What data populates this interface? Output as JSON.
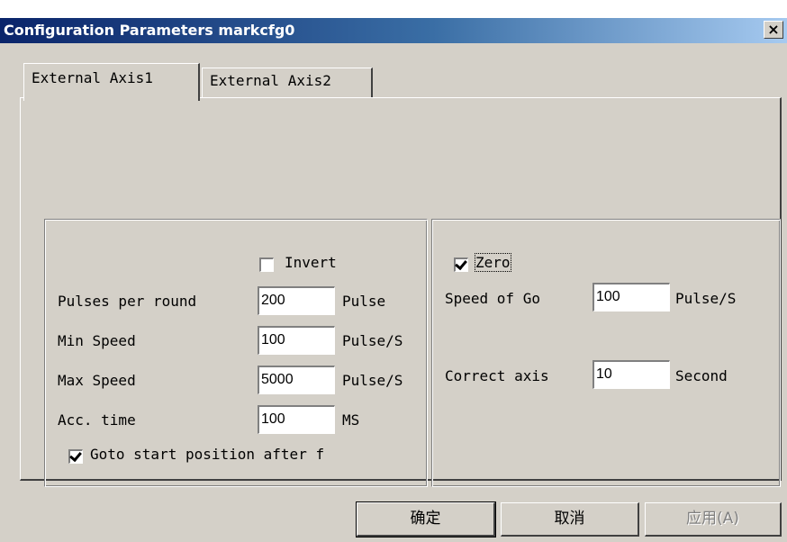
{
  "window": {
    "title": "Configuration Parameters markcfg0",
    "close_label": "×"
  },
  "tabs": [
    {
      "label": "External Axis1",
      "active": true
    },
    {
      "label": "External Axis2",
      "active": false
    }
  ],
  "left_group": {
    "invert": {
      "label": "Invert",
      "checked": false
    },
    "pulses_per_round": {
      "label": "Pulses per round",
      "value": "200",
      "unit": "Pulse"
    },
    "min_speed": {
      "label": "Min Speed",
      "value": "100",
      "unit": "Pulse/S"
    },
    "max_speed": {
      "label": "Max Speed",
      "value": "5000",
      "unit": "Pulse/S"
    },
    "acc_time": {
      "label": "Acc. time",
      "value": "100",
      "unit": "MS"
    },
    "goto_start": {
      "label": "Goto start position after f",
      "checked": true
    }
  },
  "right_group": {
    "zero": {
      "label": "Zero",
      "checked": true
    },
    "speed_of_go": {
      "label": "Speed of Go",
      "value": "100",
      "unit": "Pulse/S"
    },
    "correct_axis": {
      "label": "Correct axis",
      "value": "10",
      "unit": "Second"
    }
  },
  "buttons": {
    "ok": "确定",
    "cancel": "取消",
    "apply": "应用(A)"
  },
  "colors": {
    "dialog_face": "#d4d0c8",
    "title_start": "#0a246a",
    "title_end": "#a6caf0"
  }
}
